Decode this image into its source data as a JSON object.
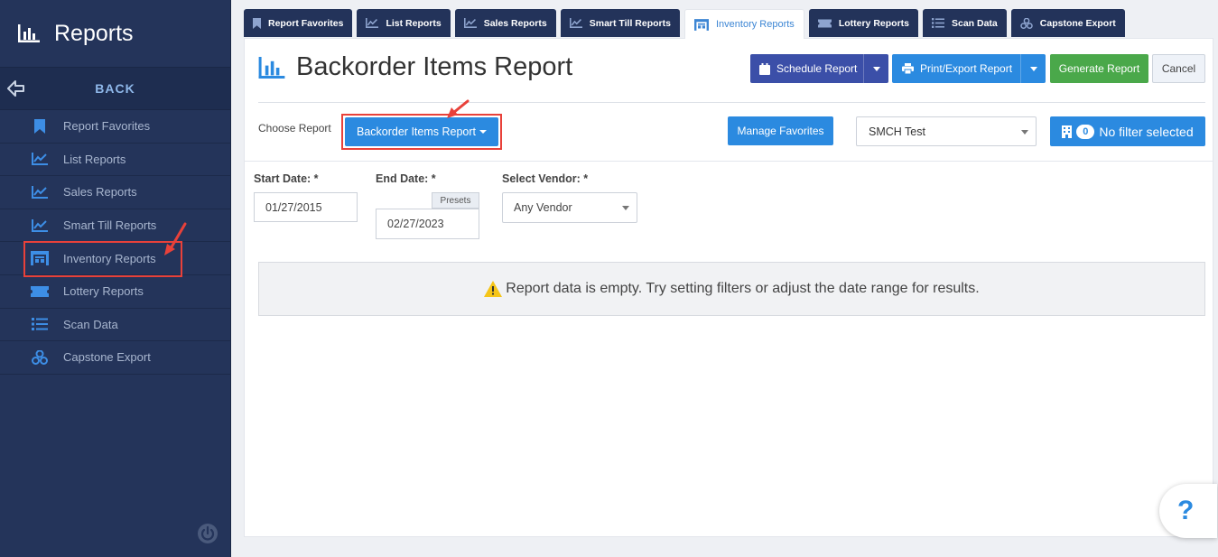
{
  "sidebar": {
    "title": "Reports",
    "back_label": "BACK",
    "items": [
      {
        "label": "Report Favorites",
        "icon": "bookmark-icon"
      },
      {
        "label": "List Reports",
        "icon": "line-chart-icon"
      },
      {
        "label": "Sales Reports",
        "icon": "line-chart-icon"
      },
      {
        "label": "Smart Till Reports",
        "icon": "line-chart-icon"
      },
      {
        "label": "Inventory Reports",
        "icon": "warehouse-icon"
      },
      {
        "label": "Lottery Reports",
        "icon": "ticket-icon"
      },
      {
        "label": "Scan Data",
        "icon": "list-icon"
      },
      {
        "label": "Capstone Export",
        "icon": "cubes-icon"
      }
    ]
  },
  "tabs": [
    {
      "label": "Report Favorites"
    },
    {
      "label": "List Reports"
    },
    {
      "label": "Sales Reports"
    },
    {
      "label": "Smart Till Reports"
    },
    {
      "label": "Inventory Reports"
    },
    {
      "label": "Lottery Reports"
    },
    {
      "label": "Scan Data"
    },
    {
      "label": "Capstone Export"
    }
  ],
  "header": {
    "title": "Backorder Items Report",
    "schedule_label": "Schedule Report",
    "print_label": "Print/Export Report",
    "generate_label": "Generate Report",
    "cancel_label": "Cancel"
  },
  "toolbar": {
    "choose_label": "Choose Report",
    "report_select": "Backorder Items Report",
    "manage_favorites": "Manage Favorites",
    "store_select": "SMCH Test",
    "filter_count": "0",
    "filter_label": "No filter selected"
  },
  "filters": {
    "start_label": "Start Date: *",
    "start_value": "01/27/2015",
    "end_label": "End Date: *",
    "end_value": "02/27/2023",
    "presets_label": "Presets",
    "vendor_label": "Select Vendor: *",
    "vendor_value": "Any Vendor"
  },
  "empty_message": "Report data is empty. Try setting filters or adjust the date range for results.",
  "help_label": "?",
  "colors": {
    "sidebar_bg": "#24345a",
    "primary": "#2b8ae0",
    "schedule": "#3b4fa8",
    "generate": "#4aa84a",
    "highlight": "#e8413a",
    "warning": "#f5c518"
  }
}
